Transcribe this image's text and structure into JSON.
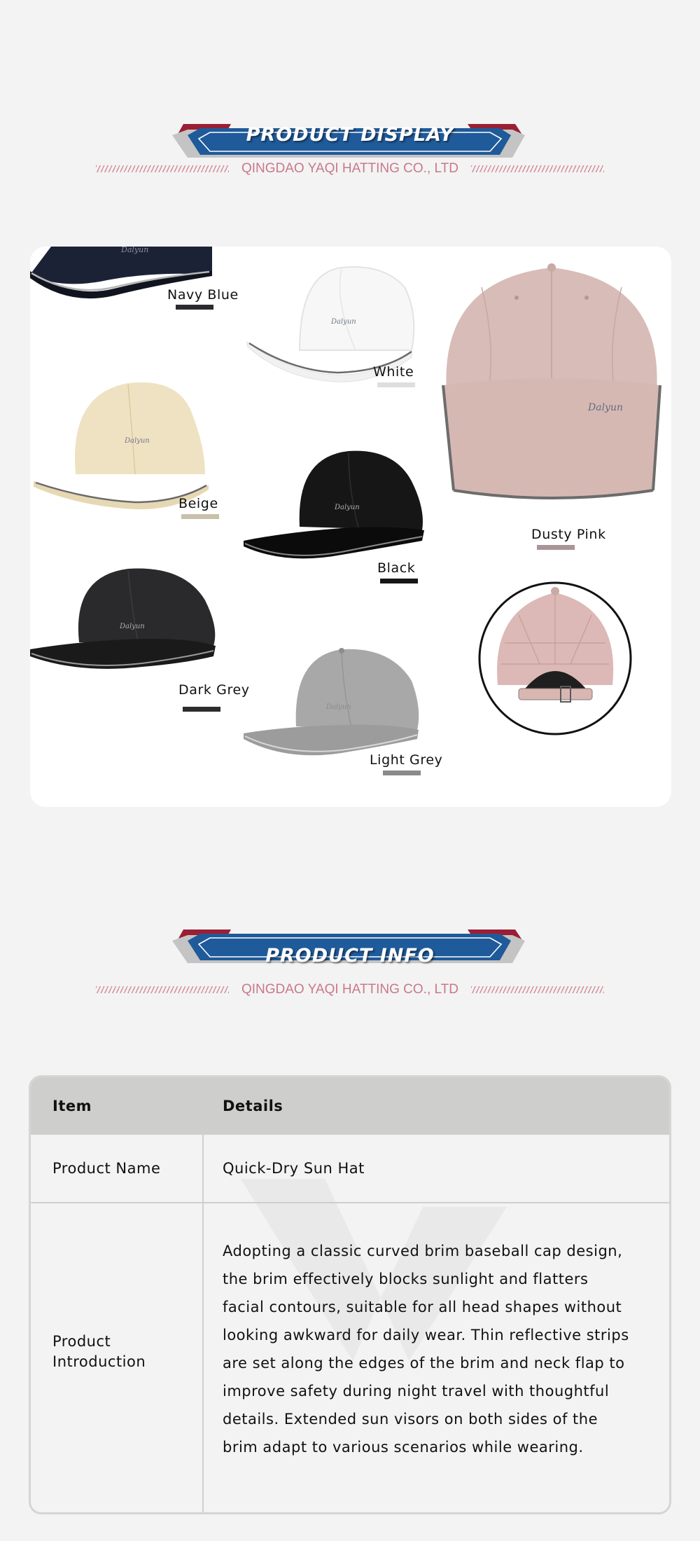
{
  "section_display": {
    "title": "PRODUCT DISPLAY",
    "company": "QINGDAO YAQI HATTING CO., LTD"
  },
  "colors_display": [
    {
      "label": "Navy Blue",
      "swatch": "#2b2b2f",
      "cap": "#1c2236"
    },
    {
      "label": "White",
      "swatch": "#dedede",
      "cap": "#f7f7f7"
    },
    {
      "label": "Dusty Pink",
      "swatch": "#a99597",
      "cap": "#d8bcb8"
    },
    {
      "label": "Beige",
      "swatch": "#c8c0aa",
      "cap": "#efe2c2"
    },
    {
      "label": "Black",
      "swatch": "#161616",
      "cap": "#161616"
    },
    {
      "label": "Dark Grey",
      "swatch": "#2c2c2c",
      "cap": "#2a2a2c"
    },
    {
      "label": "Light Grey",
      "swatch": "#8a8a8a",
      "cap": "#a8a8a8"
    }
  ],
  "section_info": {
    "title": "PRODUCT INFO",
    "company": "QINGDAO YAQI HATTING CO., LTD"
  },
  "table": {
    "header_item": "Item",
    "header_details": "Details",
    "row1_item": "Product Name",
    "row1_details": "Quick-Dry Sun Hat",
    "row2_item_line1": "Product",
    "row2_item_line2": "Introduction",
    "row2_details": [
      "Adopting a classic curved brim baseball cap design,",
      "the brim effectively blocks sunlight and flatters",
      "facial contours, suitable for all head shapes without",
      "looking awkward for daily wear. Thin reflective strips",
      "are set along the edges of the brim and neck flap to",
      "improve safety during night travel with thoughtful",
      "details. Extended sun visors on both sides of the",
      "brim adapt to various scenarios while wearing."
    ]
  },
  "theme": {
    "banner_blue": "#1f5a9a",
    "banner_red": "#9b1f34",
    "banner_grey": "#c4c4c4",
    "company_pink": "#c9788a"
  }
}
